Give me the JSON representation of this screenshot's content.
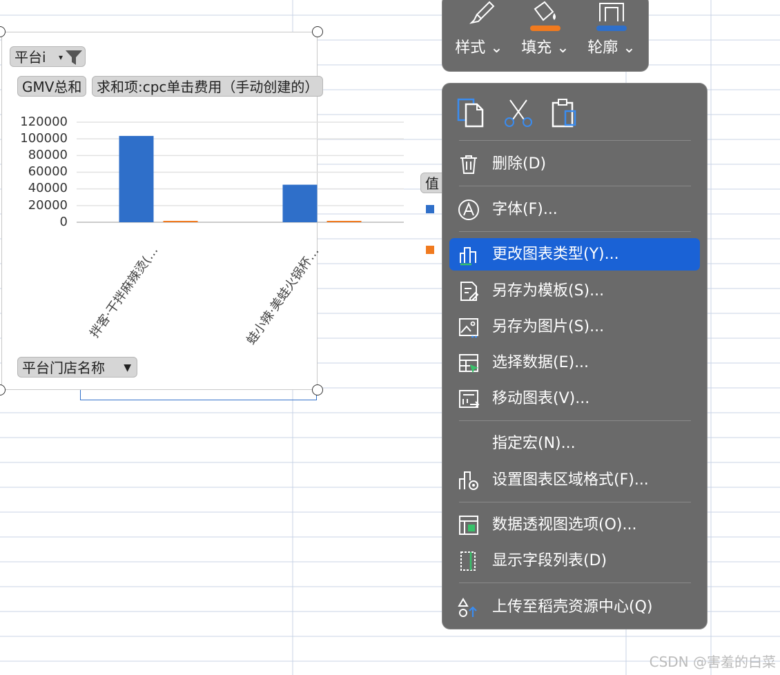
{
  "chart": {
    "filter_chip": "平台i",
    "legend_partial_label": "值",
    "value_buttons": [
      "GMV总和",
      "求和项:cpc单击费用（手动创建的）"
    ],
    "axis_field_button": "平台门店名称",
    "colors": {
      "series1": "#2f6fc9",
      "series2": "#f07a1f"
    }
  },
  "chart_data": {
    "type": "bar",
    "categories": [
      "拌客·干拌麻辣烫(…",
      "蛙小辣·美蛙火锅杯…"
    ],
    "series": [
      {
        "values": [
          103500,
          45000
        ],
        "color": "#2f6fc9"
      },
      {
        "values": [
          1200,
          1000
        ],
        "color": "#f07a1f"
      }
    ],
    "yticks": [
      "120000",
      "100000",
      "80000",
      "60000",
      "40000",
      "20000",
      "0"
    ],
    "ylim": [
      0,
      120000
    ],
    "grid": true
  },
  "toolbar": {
    "items": [
      {
        "label": "样式",
        "icon": "brush-icon"
      },
      {
        "label": "填充",
        "icon": "fill-bucket-icon",
        "accent": "#f07a1f"
      },
      {
        "label": "轮廓",
        "icon": "outline-icon",
        "accent": "#2f6fc9"
      }
    ]
  },
  "context_menu": {
    "clipboard_icons": [
      "copy-icon",
      "cut-icon",
      "paste-icon"
    ],
    "items": [
      {
        "label": "删除(D)",
        "icon": "trash-icon"
      },
      {
        "label": "字体(F)...",
        "icon": "font-icon"
      },
      {
        "label": "更改图表类型(Y)...",
        "icon": "change-chart-type-icon",
        "highlighted": true
      },
      {
        "label": "另存为模板(S)...",
        "icon": "save-template-icon"
      },
      {
        "label": "另存为图片(S)...",
        "icon": "save-image-icon"
      },
      {
        "label": "选择数据(E)...",
        "icon": "select-data-icon"
      },
      {
        "label": "移动图表(V)...",
        "icon": "move-chart-icon"
      },
      {
        "label": "指定宏(N)...",
        "icon": ""
      },
      {
        "label": "设置图表区域格式(F)...",
        "icon": "format-chart-area-icon"
      },
      {
        "label": "数据透视图选项(O)...",
        "icon": "pivot-options-icon"
      },
      {
        "label": "显示字段列表(D)",
        "icon": "field-list-icon"
      },
      {
        "label": "上传至稻壳资源中心(Q)",
        "icon": "upload-icon"
      }
    ]
  },
  "watermark": "CSDN @害羞的白菜"
}
